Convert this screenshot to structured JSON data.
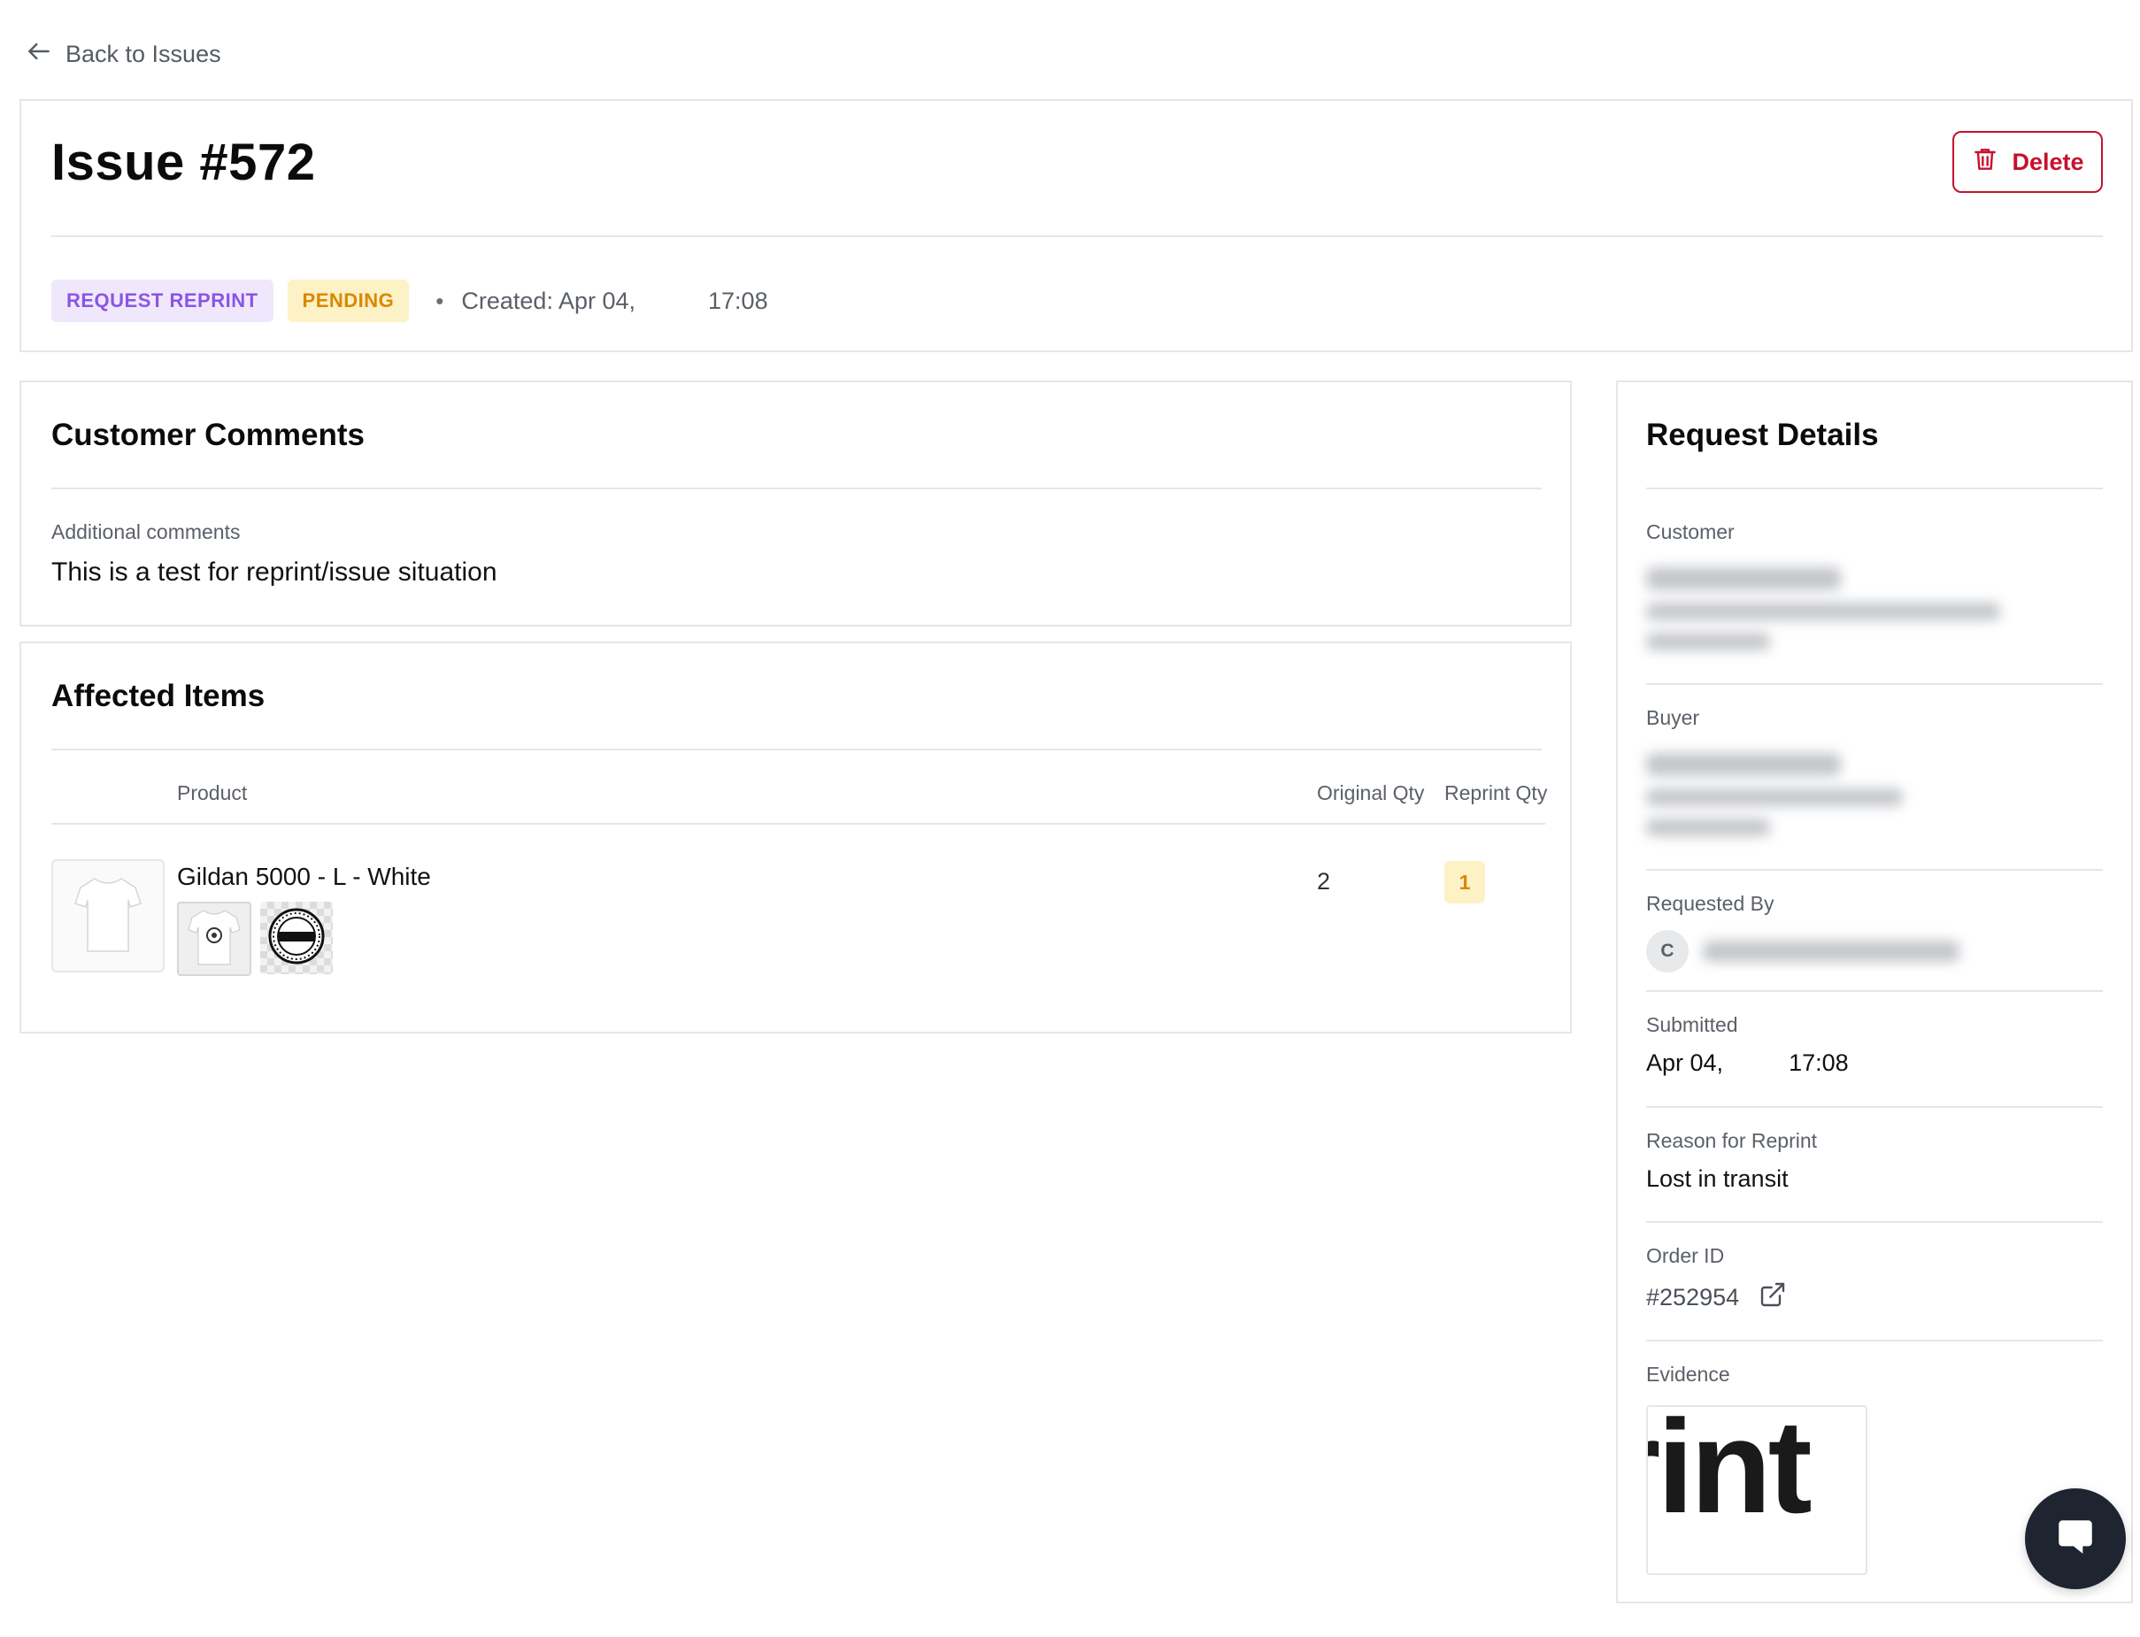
{
  "nav": {
    "back_label": "Back to Issues"
  },
  "header": {
    "title": "Issue #572",
    "delete_label": "Delete",
    "type_badge": "REQUEST REPRINT",
    "status_badge": "PENDING",
    "separator": "•",
    "created_date": "Created: Apr 04,",
    "created_time": "17:08"
  },
  "comments": {
    "title": "Customer Comments",
    "label": "Additional comments",
    "text": "This is a test for reprint/issue situation"
  },
  "items": {
    "title": "Affected Items",
    "columns": {
      "product": "Product",
      "original_qty": "Original Qty",
      "reprint_qty": "Reprint Qty"
    },
    "rows": [
      {
        "product": "Gildan 5000 - L - White",
        "original_qty": "2",
        "reprint_qty": "1"
      }
    ]
  },
  "details": {
    "title": "Request Details",
    "customer_label": "Customer",
    "buyer_label": "Buyer",
    "requested_by_label": "Requested By",
    "requested_by_initial": "C",
    "submitted_label": "Submitted",
    "submitted_date": "Apr 04,",
    "submitted_time": "17:08",
    "reason_label": "Reason for Reprint",
    "reason_value": "Lost in transit",
    "order_label": "Order ID",
    "order_value": "#252954",
    "evidence_label": "Evidence",
    "evidence_image_text": "rint"
  },
  "icons": {
    "back": "arrow-left-icon",
    "delete": "trash-icon",
    "external_link": "external-link-icon",
    "chat": "chat-bubble-icon"
  },
  "colors": {
    "danger": "#c8102e",
    "type_badge_bg": "#efe8fd",
    "type_badge_text": "#8b55e3",
    "status_badge_bg": "#fdf1c6",
    "status_badge_text": "#d98800",
    "chat_fab": "#1e2430"
  }
}
